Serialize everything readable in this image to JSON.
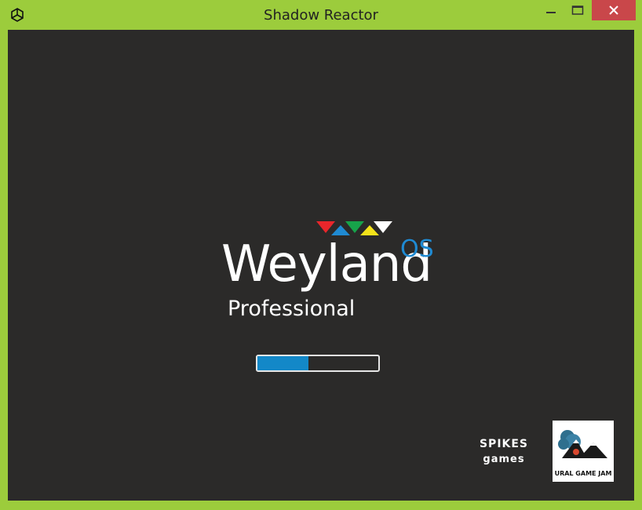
{
  "window": {
    "title": "Shadow Reactor"
  },
  "splash": {
    "brand": "Weyland",
    "superscript": "OS",
    "edition": "Professional",
    "progress_fraction": 0.42,
    "logo_triangle_colors": [
      "#e8262b",
      "#1f8ad2",
      "#17a34a",
      "#f4e21a",
      "#ffffff"
    ]
  },
  "credits": {
    "studio_line1": "SPIKES",
    "studio_line2": "games",
    "jam_label": "URAL GAME JAM"
  },
  "colors": {
    "frame": "#9ccc3c",
    "background": "#2b2a29",
    "accent": "#1388c8",
    "close_button": "#c9474a"
  },
  "icons": {
    "app": "unity-icon",
    "minimize": "minimize-icon",
    "maximize": "maximize-icon",
    "close": "close-icon"
  }
}
